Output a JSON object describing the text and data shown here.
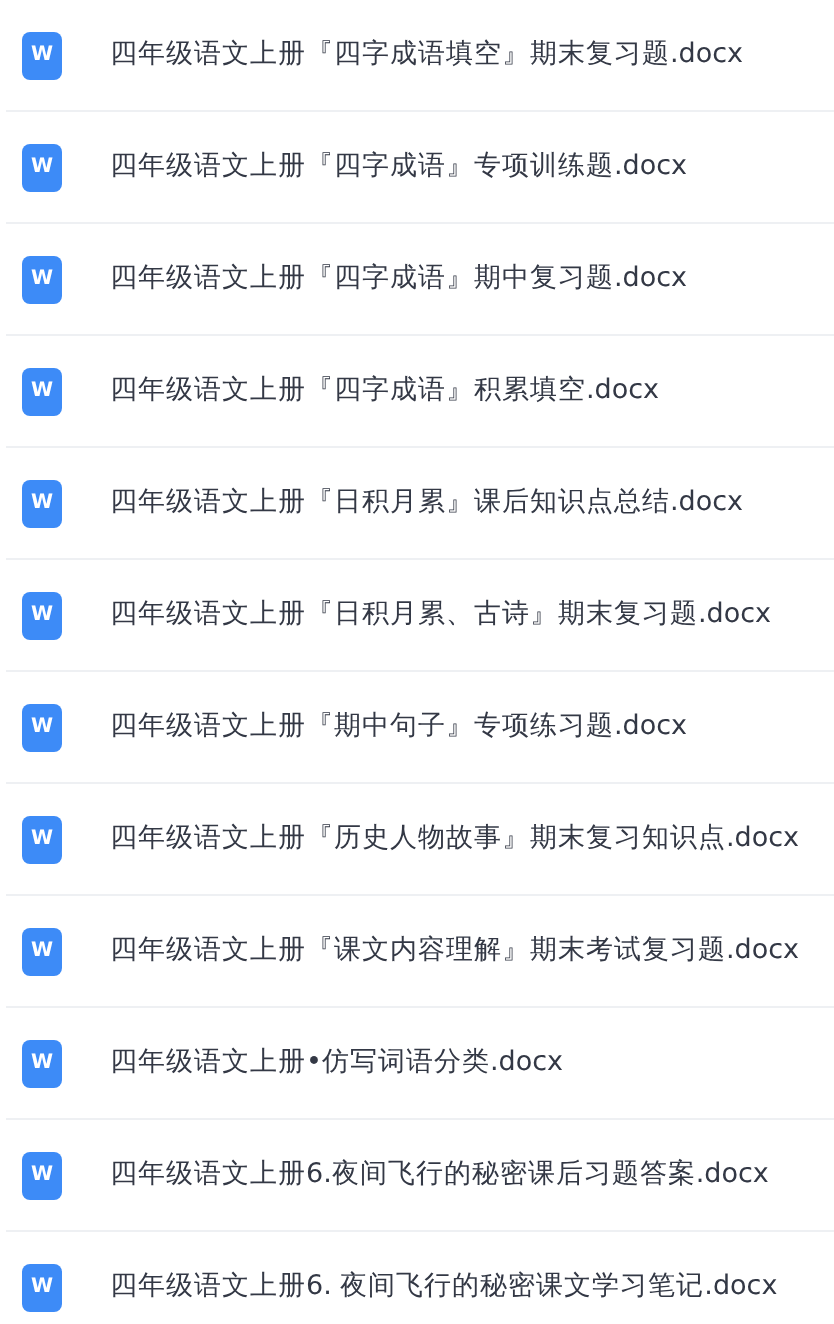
{
  "files": [
    {
      "icon_label": "W",
      "name": "四年级语文上册『四字成语填空』期末复习题.docx"
    },
    {
      "icon_label": "W",
      "name": "四年级语文上册『四字成语』专项训练题.docx"
    },
    {
      "icon_label": "W",
      "name": "四年级语文上册『四字成语』期中复习题.docx"
    },
    {
      "icon_label": "W",
      "name": "四年级语文上册『四字成语』积累填空.docx"
    },
    {
      "icon_label": "W",
      "name": "四年级语文上册『日积月累』课后知识点总结.docx"
    },
    {
      "icon_label": "W",
      "name": "四年级语文上册『日积月累、古诗』期末复习题.docx"
    },
    {
      "icon_label": "W",
      "name": "四年级语文上册『期中句子』专项练习题.docx"
    },
    {
      "icon_label": "W",
      "name": "四年级语文上册『历史人物故事』期末复习知识点.docx"
    },
    {
      "icon_label": "W",
      "name": "四年级语文上册『课文内容理解』期末考试复习题.docx"
    },
    {
      "icon_label": "W",
      "name": "四年级语文上册•仿写词语分类.docx"
    },
    {
      "icon_label": "W",
      "name": "四年级语文上册6.夜间飞行的秘密课后习题答案.docx"
    },
    {
      "icon_label": "W",
      "name": "四年级语文上册6. 夜间飞行的秘密课文学习笔记.docx"
    }
  ]
}
